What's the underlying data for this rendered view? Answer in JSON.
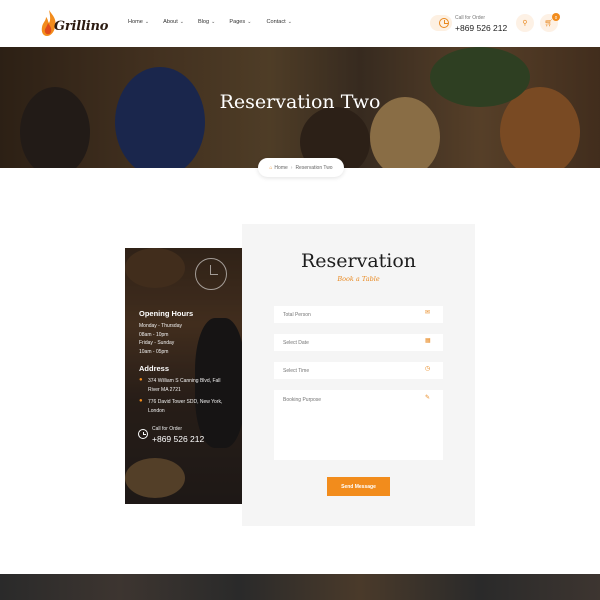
{
  "brand": {
    "name": "Grillino"
  },
  "nav": [
    {
      "label": "Home"
    },
    {
      "label": "About"
    },
    {
      "label": "Blog"
    },
    {
      "label": "Pages"
    },
    {
      "label": "Contact"
    }
  ],
  "header": {
    "order_label": "Call for Order",
    "order_phone": "+869 526 212",
    "cart_count": "0"
  },
  "hero": {
    "title": "Reservation Two",
    "breadcrumb_home": "Home",
    "breadcrumb_current": "Reservation Two"
  },
  "info": {
    "hours_heading": "Opening Hours",
    "hours": [
      "Monday - Thursday",
      "08am - 10pm",
      "Friday - Sunday",
      "10am - 05pm"
    ],
    "address_heading": "Address",
    "address_1": "374 William S Canning Blvd, Fall River MA 2721",
    "address_2": "776 David Tower SDD, New York, London",
    "call_label": "Call for Order",
    "call_phone": "+869 526 212"
  },
  "form": {
    "title": "Reservation",
    "subtitle": "Book a Table",
    "total_person_placeholder": "Total Person",
    "date_placeholder": "Select Date",
    "time_placeholder": "Select Time",
    "purpose_placeholder": "Booking Purpose",
    "submit_label": "Send Message"
  },
  "colors": {
    "accent": "#f28c1c",
    "panel_bg": "#f5f5f5"
  },
  "icons": [
    "flame-logo-icon",
    "chevron-down-icon",
    "clock-icon",
    "search-icon",
    "cart-icon",
    "home-icon",
    "alarm-clock-icon",
    "map-pin-icon",
    "phone-icon",
    "mail-icon",
    "calendar-icon",
    "pencil-icon"
  ]
}
